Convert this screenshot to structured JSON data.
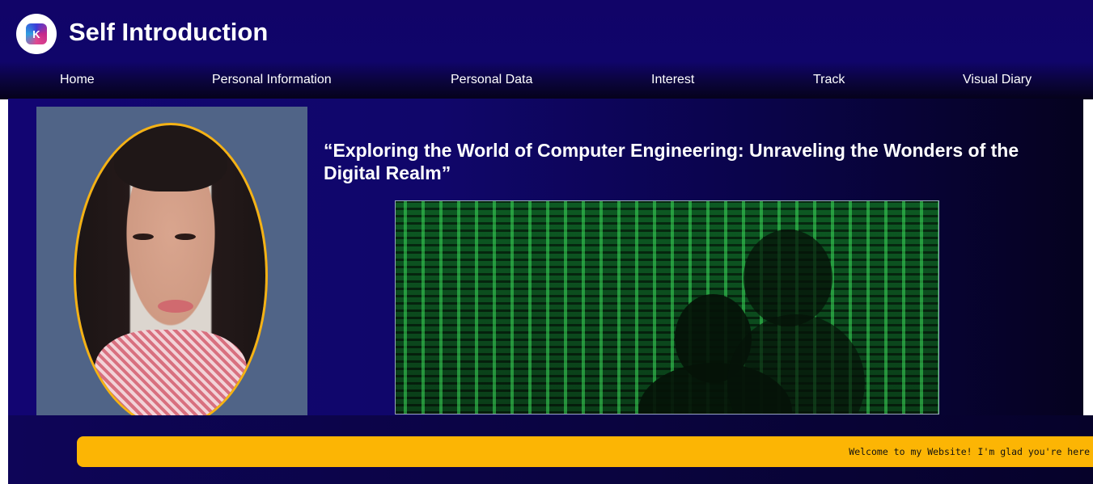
{
  "header": {
    "title": "Self Introduction",
    "logo_icon": "k-logo-icon"
  },
  "nav": {
    "items": [
      {
        "label": "Home"
      },
      {
        "label": "Personal Information"
      },
      {
        "label": "Personal Data"
      },
      {
        "label": "Interest"
      },
      {
        "label": "Track"
      },
      {
        "label": "Visual Diary"
      }
    ]
  },
  "main": {
    "headline": "“Exploring the World of Computer Engineering: Unraveling the Wonders of the Digital Realm”",
    "profile_image": "profile-portrait",
    "feature_image": "matrix-binary-code-image"
  },
  "footer": {
    "marquee_text": "Welcome to my Website! I'm glad you're here"
  },
  "colors": {
    "header_bg": "#110468",
    "marquee_bg": "#fcb504",
    "portrait_border": "#f5b213",
    "profile_box_bg": "#506487"
  }
}
